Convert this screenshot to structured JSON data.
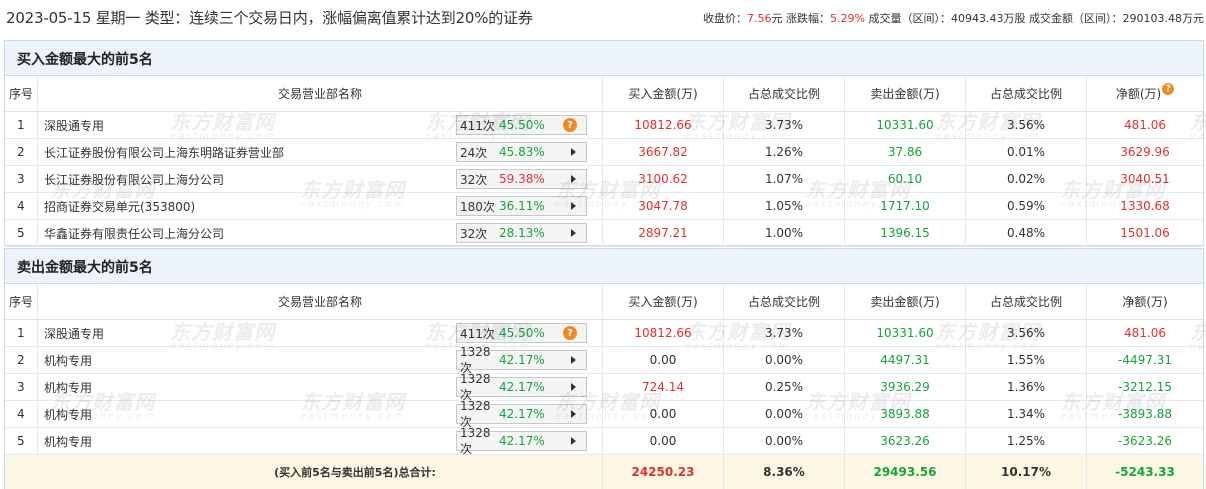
{
  "header": {
    "title": "2023-05-15 星期一 类型：连续三个交易日内，涨幅偏离值累计达到20%的证券",
    "close_label": "收盘价：",
    "close_value": "7.56",
    "close_unit": "元",
    "change_label": "涨跌幅：",
    "change_value": "5.29%",
    "volume_label": "成交量（区间）：",
    "volume_value": "40943.43万股",
    "amount_label": "成交金额（区间）：",
    "amount_value": "290103.48万元"
  },
  "columns": {
    "idx": "序号",
    "name": "交易营业部名称",
    "buy": "买入金额(万)",
    "buy_pct": "占总成交比例",
    "sell": "卖出金额(万)",
    "sell_pct": "占总成交比例",
    "net": "净额(万)"
  },
  "buy_section": {
    "title": "买入金额最大的前5名",
    "rows": [
      {
        "idx": "1",
        "name": "深股通专用",
        "count": "411次",
        "pct": "45.50%",
        "pct_color": "green",
        "marker": "question",
        "buy": "10812.66",
        "buy_pct": "3.73%",
        "sell": "10331.60",
        "sell_pct": "3.56%",
        "net": "481.06",
        "net_color": "red"
      },
      {
        "idx": "2",
        "name": "长江证券股份有限公司上海东明路证券营业部",
        "count": "24次",
        "pct": "45.83%",
        "pct_color": "green",
        "marker": "arrow",
        "buy": "3667.82",
        "buy_pct": "1.26%",
        "sell": "37.86",
        "sell_pct": "0.01%",
        "net": "3629.96",
        "net_color": "red"
      },
      {
        "idx": "3",
        "name": "长江证券股份有限公司上海分公司",
        "count": "32次",
        "pct": "59.38%",
        "pct_color": "red",
        "marker": "arrow",
        "buy": "3100.62",
        "buy_pct": "1.07%",
        "sell": "60.10",
        "sell_pct": "0.02%",
        "net": "3040.51",
        "net_color": "red"
      },
      {
        "idx": "4",
        "name": "招商证券交易单元(353800)",
        "count": "180次",
        "pct": "36.11%",
        "pct_color": "green",
        "marker": "arrow",
        "buy": "3047.78",
        "buy_pct": "1.05%",
        "sell": "1717.10",
        "sell_pct": "0.59%",
        "net": "1330.68",
        "net_color": "red"
      },
      {
        "idx": "5",
        "name": "华鑫证券有限责任公司上海分公司",
        "count": "32次",
        "pct": "28.13%",
        "pct_color": "green",
        "marker": "arrow",
        "buy": "2897.21",
        "buy_pct": "1.00%",
        "sell": "1396.15",
        "sell_pct": "0.48%",
        "net": "1501.06",
        "net_color": "red"
      }
    ]
  },
  "sell_section": {
    "title": "卖出金额最大的前5名",
    "rows": [
      {
        "idx": "1",
        "name": "深股通专用",
        "count": "411次",
        "pct": "45.50%",
        "pct_color": "green",
        "marker": "question",
        "buy": "10812.66",
        "buy_pct": "3.73%",
        "sell": "10331.60",
        "sell_pct": "3.56%",
        "net": "481.06",
        "net_color": "red",
        "buy_color": "red"
      },
      {
        "idx": "2",
        "name": "机构专用",
        "count": "1328次",
        "pct": "42.17%",
        "pct_color": "green",
        "marker": "arrow",
        "buy": "0.00",
        "buy_pct": "0.00%",
        "sell": "4497.31",
        "sell_pct": "1.55%",
        "net": "-4497.31",
        "net_color": "green",
        "buy_color": "dark"
      },
      {
        "idx": "3",
        "name": "机构专用",
        "count": "1328次",
        "pct": "42.17%",
        "pct_color": "green",
        "marker": "arrow",
        "buy": "724.14",
        "buy_pct": "0.25%",
        "sell": "3936.29",
        "sell_pct": "1.36%",
        "net": "-3212.15",
        "net_color": "green",
        "buy_color": "red"
      },
      {
        "idx": "4",
        "name": "机构专用",
        "count": "1328次",
        "pct": "42.17%",
        "pct_color": "green",
        "marker": "arrow",
        "buy": "0.00",
        "buy_pct": "0.00%",
        "sell": "3893.88",
        "sell_pct": "1.34%",
        "net": "-3893.88",
        "net_color": "green",
        "buy_color": "dark"
      },
      {
        "idx": "5",
        "name": "机构专用",
        "count": "1328次",
        "pct": "42.17%",
        "pct_color": "green",
        "marker": "arrow",
        "buy": "0.00",
        "buy_pct": "0.00%",
        "sell": "3623.26",
        "sell_pct": "1.25%",
        "net": "-3623.26",
        "net_color": "green",
        "buy_color": "dark"
      }
    ]
  },
  "total": {
    "label_prefix": "(买入前5名与卖出前5名)",
    "label_bold": "总合计:",
    "buy": "24250.23",
    "buy_pct": "8.36%",
    "sell": "29493.56",
    "sell_pct": "10.17%",
    "net": "-5243.33"
  },
  "watermark": {
    "cn": "东方财富网",
    "en": "eastmoney.com"
  },
  "colors": {
    "up": "#e0312d",
    "down": "#14a53a",
    "header_bg": "#edf3fb",
    "border": "#c9dbee",
    "total_bg": "#fdf8e4",
    "help_icon": "#f08a24"
  }
}
